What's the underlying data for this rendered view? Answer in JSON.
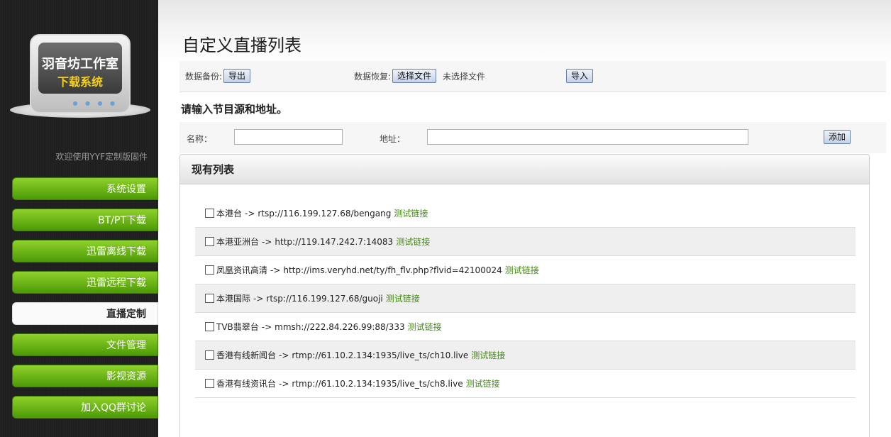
{
  "sidebar": {
    "logo_line1": "羽音坊工作室",
    "logo_line2": "下载系统",
    "welcome": "欢迎使用YYF定制版固件",
    "items": [
      {
        "label": "系统设置",
        "active": false
      },
      {
        "label": "BT/PT下载",
        "active": false
      },
      {
        "label": "迅雷离线下载",
        "active": false
      },
      {
        "label": "迅雷远程下载",
        "active": false
      },
      {
        "label": "直播定制",
        "active": true
      },
      {
        "label": "文件管理",
        "active": false
      },
      {
        "label": "影视资源",
        "active": false
      },
      {
        "label": "加入QQ群讨论",
        "active": false
      }
    ]
  },
  "main": {
    "title": "自定义直播列表",
    "backup": {
      "label": "数据备份:",
      "export_button": "导出",
      "restore_label": "数据恢复:",
      "choose_file_button": "选择文件",
      "no_file_text": "未选择文件",
      "import_button": "导入"
    },
    "prompt": "请输入节目源和地址。",
    "add_form": {
      "name_label": "名称：",
      "name_value": "",
      "address_label": "地址：",
      "address_value": "",
      "add_button": "添加"
    },
    "list_panel": {
      "title": "现有列表",
      "arrow": "->",
      "test_link_label": "测试链接",
      "items": [
        {
          "name": "本港台",
          "url": "rtsp://116.199.127.68/bengang"
        },
        {
          "name": "本港亚洲台",
          "url": "http://119.147.242.7:14083"
        },
        {
          "name": "凤凰资讯高清",
          "url": "http://ims.veryhd.net/ty/fh_flv.php?flvid=42100024"
        },
        {
          "name": "本港国际",
          "url": "rtsp://116.199.127.68/guoji"
        },
        {
          "name": "TVB翡翠台",
          "url": "mmsh://222.84.226.99:88/333"
        },
        {
          "name": "香港有线新闻台",
          "url": "rtmp://61.10.2.134:1935/live_ts/ch10.live"
        },
        {
          "name": "香港有线资讯台",
          "url": "rtmp://61.10.2.134:1935/live_ts/ch8.live"
        }
      ]
    }
  },
  "colors": {
    "nav_green": "#6cb616",
    "link_green": "#3f8a0c",
    "sidebar_bg": "#1f1f1f"
  }
}
